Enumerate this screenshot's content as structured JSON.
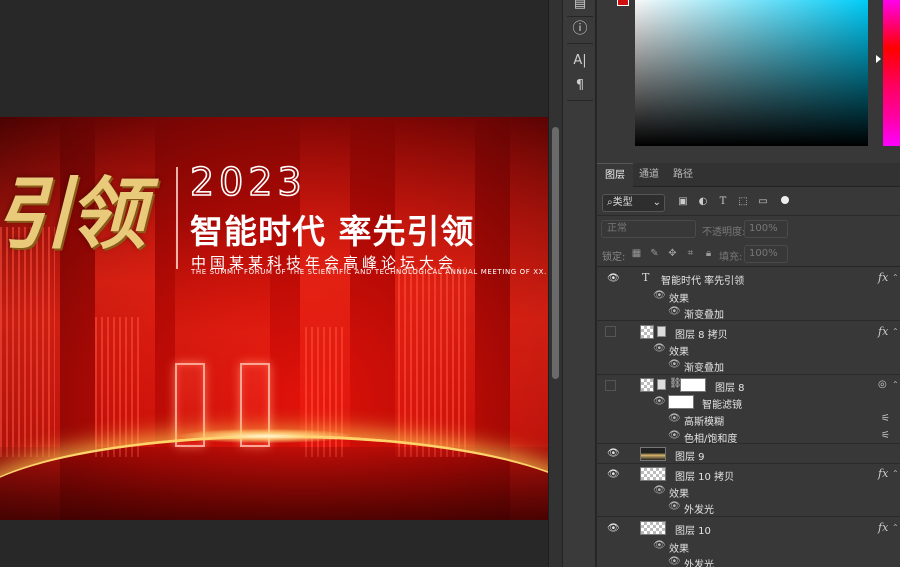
{
  "artwork": {
    "calligraphy": "引领",
    "year": "2023",
    "slogan": "智能时代 率先引领",
    "subtitle": "中国某某科技年会高峰论坛大会",
    "english_subtitle": "THE SUMMIT FORUM OF THE SCIENTIFIC AND TECHNOLOGICAL ANNUAL MEETING OF XX. CHINA"
  },
  "tool_strip": {
    "items": [
      {
        "name": "swatches-icon",
        "glyph": "▤"
      },
      {
        "name": "info-icon",
        "glyph": "ⓘ"
      },
      {
        "name": "character-icon",
        "glyph": "A|"
      },
      {
        "name": "paragraph-icon",
        "glyph": "¶"
      }
    ]
  },
  "colors": {
    "foreground_swatch": "#d01010",
    "panel_bg": "#383838",
    "canvas_bg": "#282828",
    "accent_gold": "#e9c97a"
  },
  "panel_tabs": {
    "layers": "图层",
    "channels": "通道",
    "paths": "路径"
  },
  "filter": {
    "kind": "类型",
    "kind_icon": "search-icon",
    "icons": [
      "image-filter-icon",
      "adjustment-filter-icon",
      "type-filter-icon",
      "shape-filter-icon",
      "smart-object-filter-icon"
    ]
  },
  "blend": {
    "mode": "正常",
    "opacity_label": "不透明度:",
    "opacity_value": "100%"
  },
  "lock": {
    "label": "锁定:",
    "fill_label": "填充:",
    "fill_value": "100%"
  },
  "layers": {
    "text_layer": {
      "name": "智能时代 率先引领",
      "fx": "fx",
      "effects": "效果",
      "effect_1": "渐变叠加"
    },
    "layer8_copy": {
      "name": "图层 8 拷贝",
      "fx": "fx",
      "effects": "效果",
      "effect_1": "渐变叠加"
    },
    "layer8": {
      "name": "图层 8",
      "smart_filters": "智能滤镜",
      "filter_1": "高斯模糊",
      "filter_2": "色相/饱和度"
    },
    "layer9": {
      "name": "图层 9"
    },
    "layer10_copy": {
      "name": "图层 10 拷贝",
      "fx": "fx",
      "effects": "效果",
      "effect_1": "外发光"
    },
    "layer10": {
      "name": "图层 10",
      "fx": "fx",
      "effects": "效果",
      "effect_1": "外发光"
    }
  }
}
